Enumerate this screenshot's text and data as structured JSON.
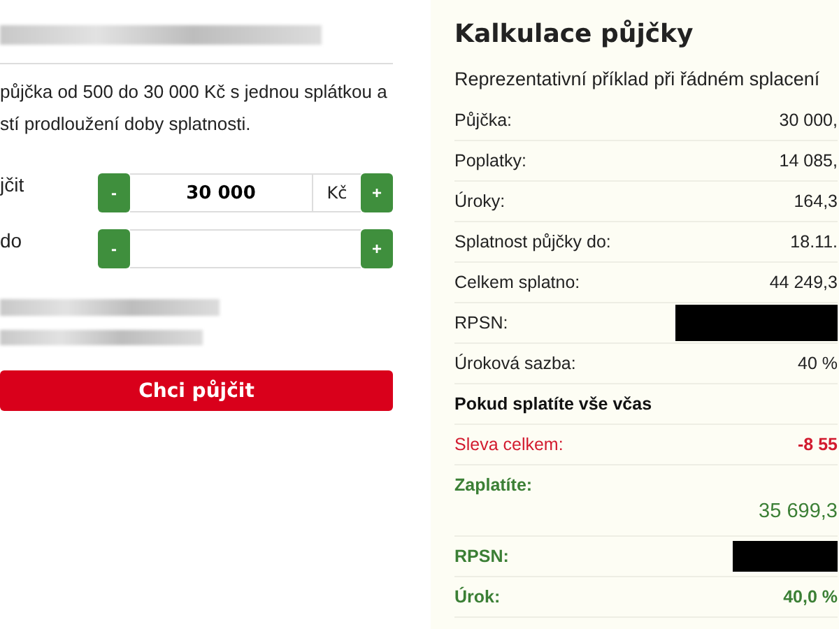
{
  "intro": [
    "půjčka od 500 do 30 000 Kč s jednou splátkou a",
    "stí prodloužení doby splatnosti."
  ],
  "form": [
    {
      "label": "jčit",
      "value": "30 000",
      "unit": "Kč",
      "minus": "-",
      "plus": "+"
    },
    {
      "label": "do",
      "minus": "-",
      "plus": "+"
    }
  ],
  "submit": "Chci půjčit",
  "calc": {
    "title": "Kalkulace půjčky",
    "subtitle": "Reprezentativní příklad při řádném splacení",
    "rows": [
      {
        "kind": "plain",
        "label": "Půjčka:",
        "value": "30 000,"
      },
      {
        "kind": "plain",
        "label": "Poplatky:",
        "value": "14 085,"
      },
      {
        "kind": "plain",
        "label": "Úroky:",
        "value": "164,3"
      },
      {
        "kind": "plain",
        "label": "Splatnost půjčky do:",
        "value": "18.11."
      },
      {
        "kind": "plain",
        "label": "Celkem splatno:",
        "value": "44 249,3"
      },
      {
        "kind": "plain",
        "label": "RPSN:",
        "redacted": true
      },
      {
        "kind": "plain",
        "label": "Úroková sazba:",
        "value": "40 %"
      },
      {
        "kind": "heading",
        "label": "Pokud splatíte vše včas"
      },
      {
        "kind": "discount",
        "label": "Sleva celkem:",
        "value": "-8 55"
      },
      {
        "kind": "total",
        "label": "Zaplatíte:",
        "value": "35 699,3"
      },
      {
        "kind": "green",
        "label": "RPSN:",
        "redacted": true
      },
      {
        "kind": "green",
        "label": "Úrok:",
        "value": "40,0 %"
      }
    ]
  }
}
